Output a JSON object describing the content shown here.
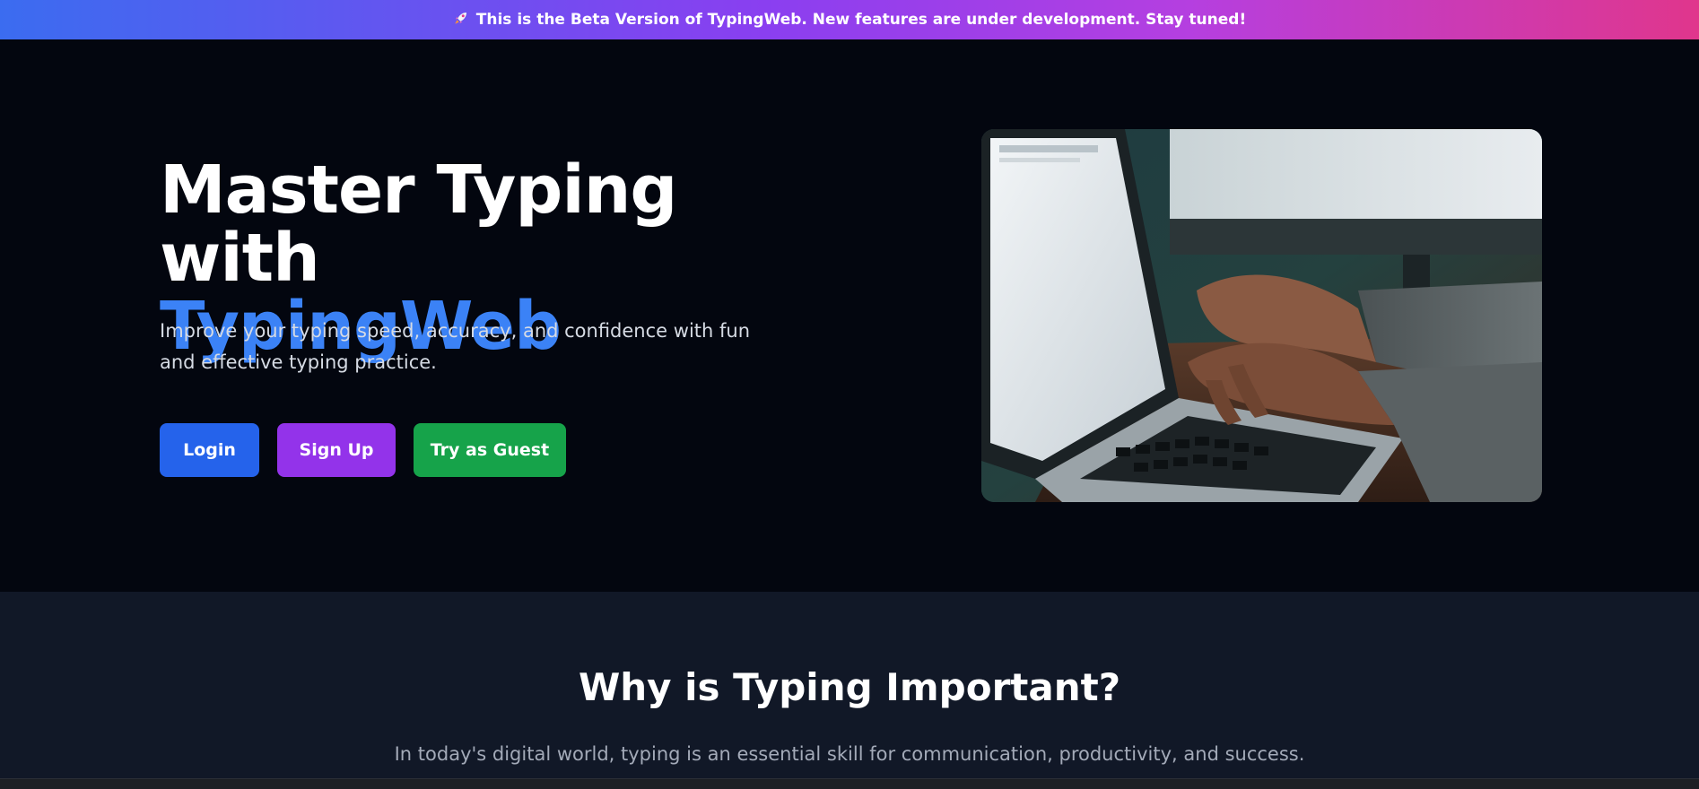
{
  "banner": {
    "icon": "rocket-icon",
    "text": "This is the Beta Version of TypingWeb. New features are under development. Stay tuned!"
  },
  "hero": {
    "title_line1": "Master Typing with",
    "title_accent": "TypingWeb",
    "subtitle": "Improve your typing speed, accuracy, and confidence with fun and effective typing practice.",
    "buttons": {
      "login": "Login",
      "signup": "Sign Up",
      "guest": "Try as Guest"
    }
  },
  "why": {
    "title": "Why is Typing Important?",
    "text": "In today's digital world, typing is an essential skill for communication, productivity, and success."
  },
  "colors": {
    "accent": "#3b82f6",
    "login": "#2563eb",
    "signup": "#9333ea",
    "guest": "#16a34a"
  }
}
